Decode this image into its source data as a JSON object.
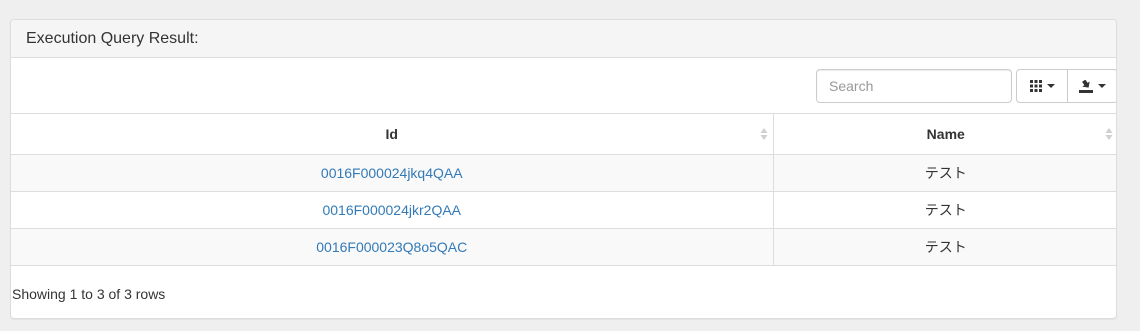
{
  "panel": {
    "title": "Execution Query Result:"
  },
  "toolbar": {
    "search_placeholder": "Search",
    "columns_icon": "columns-grid-icon",
    "export_icon": "export-download-icon"
  },
  "table": {
    "columns": [
      "Id",
      "Name"
    ],
    "rows": [
      {
        "id": "0016F000024jkq4QAA",
        "name": "テスト"
      },
      {
        "id": "0016F000024jkr2QAA",
        "name": "テスト"
      },
      {
        "id": "0016F000023Q8o5QAC",
        "name": "テスト"
      }
    ]
  },
  "pagination": {
    "summary": "Showing 1 to 3 of 3 rows"
  },
  "colors": {
    "link": "#337ab7",
    "stripe": "#f9f9f9",
    "border": "#dddddd",
    "heading_bg": "#f5f5f5"
  }
}
